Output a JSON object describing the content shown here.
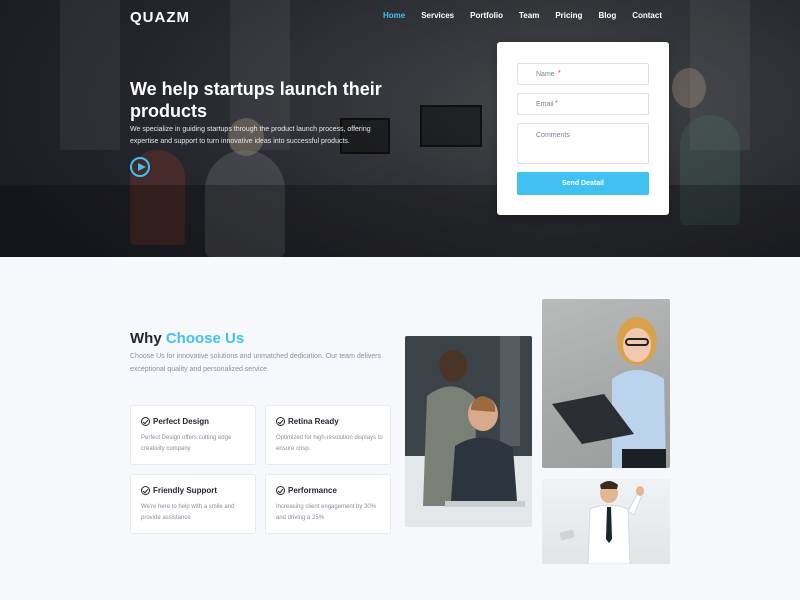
{
  "nav": {
    "logo": "QUAZM",
    "items": [
      {
        "label": "Home",
        "active": true
      },
      {
        "label": "Services",
        "active": false
      },
      {
        "label": "Portfolio",
        "active": false
      },
      {
        "label": "Team",
        "active": false
      },
      {
        "label": "Pricing",
        "active": false
      },
      {
        "label": "Blog",
        "active": false
      },
      {
        "label": "Contact",
        "active": false
      }
    ]
  },
  "hero": {
    "title": "We help startups launch their products",
    "text": "We specialize in guiding startups through the product launch process, offering expertise and support to turn innovative ideas into successful products.",
    "play_icon": "play-icon"
  },
  "form": {
    "name_placeholder": "Name",
    "email_placeholder": "Email",
    "comments_placeholder": "Comments",
    "required_mark": "*",
    "submit_label": "Send Deatail"
  },
  "why": {
    "title_prefix": "Why ",
    "title_accent": "Choose Us",
    "text": "Choose Us for innovative solutions and unmatched dedication. Our team delivers exceptional quality and personalized service.",
    "features": [
      {
        "title": "Perfect Design",
        "desc": "Perfect Design offers cutting edge creativity company"
      },
      {
        "title": "Retina Ready",
        "desc": "Optimized for high-resolution displays to ensure crisp."
      },
      {
        "title": "Friendly Support",
        "desc": "We're here to help with a smile and provide assistance"
      },
      {
        "title": "Performance",
        "desc": "Increasing client engagement by 30% and driving a 25%"
      }
    ]
  },
  "colors": {
    "accent": "#41c0f4",
    "required": "#e03b3b"
  }
}
